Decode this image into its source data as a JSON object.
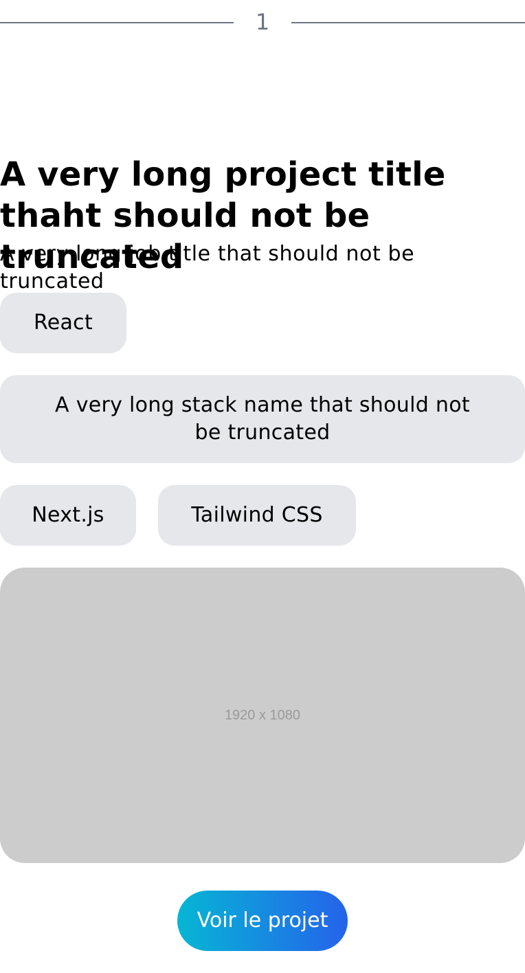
{
  "section": {
    "number": "1",
    "line_color": "#6b7280"
  },
  "project": {
    "title": "A very long project title thaht should not be truncated",
    "job_title": "A very long job title that should not be truncated"
  },
  "stack": [
    "React",
    "A very long stack name that should not be truncated",
    "Next.js",
    "Tailwind CSS"
  ],
  "image": {
    "placeholder_text": "1920 x 1080",
    "placeholder_color": "#cccccc"
  },
  "cta": {
    "label": "Voir le projet",
    "gradient_from": "#06b6d4",
    "gradient_to": "#2563eb"
  }
}
